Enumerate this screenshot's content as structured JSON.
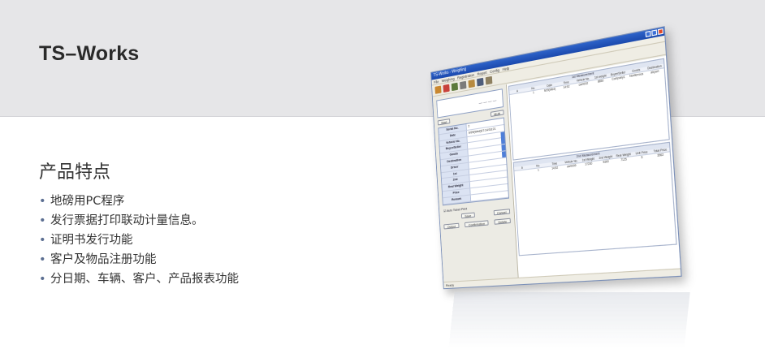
{
  "header": {
    "title": "TS–Works"
  },
  "features": {
    "heading": "产品特点",
    "items": [
      "地磅用PC程序",
      "发行票据打印联动计量信息。",
      "证明书发行功能",
      "客户及物品注册功能",
      "分日期、车辆、客户、产品报表功能"
    ]
  },
  "app": {
    "title": "TS-Works - Weighing",
    "menu": [
      "File",
      "Weighing",
      "Registration",
      "Report",
      "Config",
      "Help"
    ],
    "buttons": {
      "start": "Start",
      "multi": "Multi",
      "save": "Save",
      "cancel": "Cancel",
      "output": "Output",
      "confirmation": "Confirmation",
      "delete": "Delete"
    },
    "form": [
      {
        "label": "Serial No.",
        "value": "2"
      },
      {
        "label": "Date",
        "value": "9/29(Wed)07:14/18:21"
      },
      {
        "label": "Vehicle No.",
        "value": ""
      },
      {
        "label": "Buyer/Seller",
        "value": ""
      },
      {
        "label": "Goods",
        "value": ""
      },
      {
        "label": "Destination",
        "value": ""
      },
      {
        "label": "Driver",
        "value": ""
      },
      {
        "label": "1st",
        "value": ""
      },
      {
        "label": "2nd",
        "value": ""
      },
      {
        "label": "Real Weight",
        "value": ""
      },
      {
        "label": "Price",
        "value": ""
      },
      {
        "label": "Remark",
        "value": ""
      }
    ],
    "auto_ticket": "Auto Ticket Print",
    "grid_top": {
      "title": "1st Measurement",
      "columns": [
        "A",
        "No.",
        "Date",
        "Time",
        "Vehicle No.",
        "1st weight",
        "Buyer/Seller",
        "Goods",
        "Destination"
      ],
      "rows": [
        [
          "",
          "1",
          "9/29(Wed)",
          "14:52",
          "car0002",
          "8850",
          "Company1",
          "Nonferrous",
          "airport"
        ]
      ]
    },
    "grid_bottom": {
      "title": "2nd Measurement",
      "columns": [
        "A",
        "No.",
        "Time",
        "Vehicle No.",
        "1st Weight",
        "2nd Weight",
        "Real Weight",
        "Unit Price",
        "Total Price"
      ],
      "rows": [
        [
          "",
          "1",
          "14:52",
          "car0009",
          "17230",
          "5300",
          "7125",
          "5",
          "3562"
        ]
      ]
    },
    "status": "Ready",
    "colors": {
      "titlebar": "#1b49ad",
      "field_label_bg": "#dbe3f3"
    }
  }
}
